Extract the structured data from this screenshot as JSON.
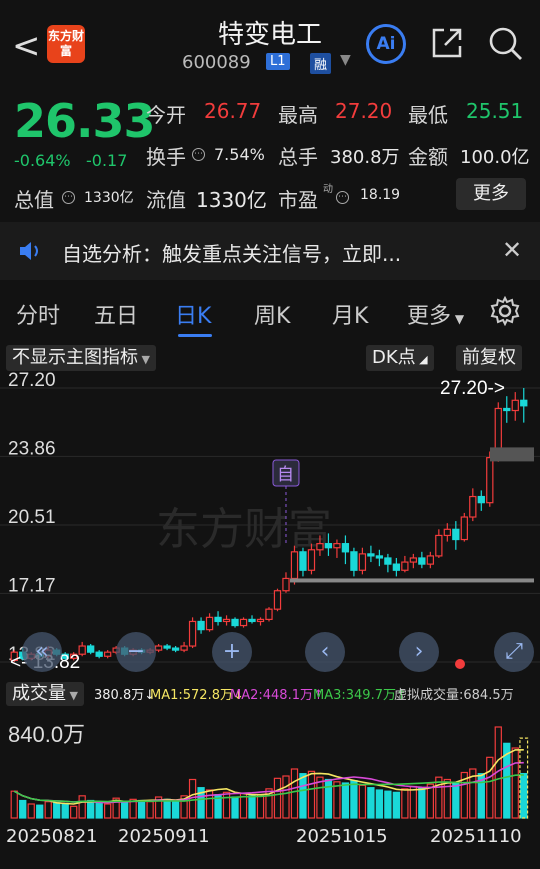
{
  "header": {
    "back_label": "<",
    "brand_label": "东方财富",
    "title": "特变电工",
    "code": "600089",
    "tag_l1": "L1",
    "tag_margin": "融"
  },
  "quote": {
    "price": "26.33",
    "change_pct": "-0.64%",
    "change_amt": "-0.17",
    "rows": [
      {
        "label": "今开",
        "value": "26.77"
      },
      {
        "label": "最高",
        "value": "27.20"
      },
      {
        "label": "最低",
        "value": "25.51"
      },
      {
        "label": "换手",
        "value": "7.54%"
      },
      {
        "label": "总手",
        "value": "380.8万"
      },
      {
        "label": "金额",
        "value": "100.0亿"
      },
      {
        "label": "总值",
        "value": "1330亿"
      },
      {
        "label": "流值",
        "value": "1330亿"
      },
      {
        "label": "市盈",
        "value": "18.19"
      }
    ],
    "pe_sup": "动",
    "more_label": "更多"
  },
  "banner": {
    "text": "自选分析：触发重点关注信号，立即..."
  },
  "tabs": [
    "分时",
    "五日",
    "日K",
    "周K",
    "月K",
    "更多"
  ],
  "toolbar": {
    "indicator_label": "不显示主图指标",
    "dk_label": "DK点",
    "adjust_label": "前复权"
  },
  "colors": {
    "up": "#f23c3c",
    "down": "#1ad8d8",
    "accent": "#3a7df2",
    "ma1": "#f5e663",
    "ma2": "#d84ad8",
    "ma3": "#3cc84a"
  },
  "chart_data": {
    "type": "candlestick",
    "y_ticks": [
      "27.20",
      "23.86",
      "20.51",
      "17.17",
      "13.82"
    ],
    "ylim": [
      13.82,
      27.2
    ],
    "max_label": "27.20->",
    "min_label": "<- 13.82",
    "marker_label": "自",
    "candles": [
      [
        13.9,
        14.3,
        13.82,
        14.4
      ],
      [
        14.3,
        14.0,
        13.9,
        14.5
      ],
      [
        14.0,
        14.2,
        13.9,
        14.3
      ],
      [
        14.2,
        14.1,
        14.0,
        14.4
      ],
      [
        14.1,
        14.4,
        14.0,
        14.6
      ],
      [
        14.4,
        14.2,
        14.1,
        14.5
      ],
      [
        14.2,
        14.0,
        13.9,
        14.3
      ],
      [
        14.0,
        14.2,
        13.9,
        14.3
      ],
      [
        14.2,
        14.6,
        14.1,
        14.8
      ],
      [
        14.6,
        14.3,
        14.2,
        14.7
      ],
      [
        14.3,
        14.1,
        14.0,
        14.4
      ],
      [
        14.1,
        14.3,
        14.0,
        14.4
      ],
      [
        14.3,
        14.5,
        14.2,
        14.6
      ],
      [
        14.5,
        14.2,
        14.1,
        14.6
      ],
      [
        14.2,
        14.4,
        14.1,
        14.5
      ],
      [
        14.4,
        14.3,
        14.2,
        14.5
      ],
      [
        14.3,
        14.4,
        14.2,
        14.5
      ],
      [
        14.4,
        14.6,
        14.3,
        14.7
      ],
      [
        14.6,
        14.5,
        14.4,
        14.7
      ],
      [
        14.5,
        14.4,
        14.3,
        14.6
      ],
      [
        14.4,
        14.6,
        14.3,
        14.8
      ],
      [
        14.6,
        15.8,
        14.5,
        16.0
      ],
      [
        15.8,
        15.4,
        15.2,
        16.0
      ],
      [
        15.4,
        16.0,
        15.3,
        16.2
      ],
      [
        16.0,
        15.8,
        15.6,
        16.3
      ],
      [
        15.8,
        15.9,
        15.6,
        16.1
      ],
      [
        15.9,
        15.6,
        15.5,
        16.0
      ],
      [
        15.6,
        15.9,
        15.5,
        16.0
      ],
      [
        15.9,
        15.8,
        15.7,
        16.1
      ],
      [
        15.8,
        15.9,
        15.6,
        16.0
      ],
      [
        15.9,
        16.4,
        15.8,
        16.5
      ],
      [
        16.4,
        17.3,
        16.3,
        17.4
      ],
      [
        17.3,
        17.9,
        17.2,
        18.2
      ],
      [
        17.9,
        19.2,
        17.6,
        19.5
      ],
      [
        19.2,
        18.3,
        18.0,
        19.4
      ],
      [
        18.3,
        19.3,
        18.1,
        19.6
      ],
      [
        19.3,
        19.6,
        19.0,
        20.0
      ],
      [
        19.6,
        19.4,
        19.0,
        20.1
      ],
      [
        19.4,
        19.6,
        18.9,
        19.8
      ],
      [
        19.6,
        19.2,
        18.6,
        20.0
      ],
      [
        19.2,
        18.3,
        18.0,
        19.4
      ],
      [
        18.3,
        19.1,
        18.1,
        19.4
      ],
      [
        19.1,
        19.0,
        18.7,
        19.5
      ],
      [
        19.0,
        18.9,
        18.5,
        19.3
      ],
      [
        18.9,
        18.6,
        18.2,
        19.1
      ],
      [
        18.6,
        18.3,
        18.0,
        18.9
      ],
      [
        18.3,
        18.7,
        18.2,
        19.0
      ],
      [
        18.7,
        18.9,
        18.4,
        19.1
      ],
      [
        18.9,
        18.6,
        18.4,
        19.2
      ],
      [
        18.6,
        19.0,
        18.4,
        19.2
      ],
      [
        19.0,
        20.0,
        18.9,
        20.3
      ],
      [
        20.0,
        20.3,
        19.7,
        20.6
      ],
      [
        20.3,
        19.8,
        19.3,
        20.7
      ],
      [
        19.8,
        20.9,
        19.7,
        21.1
      ],
      [
        20.9,
        21.9,
        20.7,
        22.3
      ],
      [
        21.9,
        21.6,
        21.2,
        22.2
      ],
      [
        21.6,
        23.8,
        21.4,
        24.1
      ],
      [
        23.8,
        26.2,
        23.6,
        26.5
      ],
      [
        26.2,
        26.1,
        25.5,
        26.8
      ],
      [
        26.1,
        26.6,
        25.6,
        27.0
      ],
      [
        26.6,
        26.33,
        25.51,
        27.2
      ]
    ],
    "volume": {
      "label": "成交量",
      "current": "380.8万↓",
      "ma1_label": "MA1:572.8万↓",
      "ma2_label": "MA2:448.1万↑",
      "ma3_label": "MA3:349.7万↑",
      "virtual_label": "虚拟成交量:684.5万",
      "max_label": "840.0万",
      "ymax": 840,
      "values": [
        230,
        150,
        120,
        110,
        140,
        130,
        120,
        100,
        190,
        150,
        130,
        120,
        170,
        140,
        160,
        150,
        140,
        180,
        160,
        140,
        190,
        330,
        260,
        240,
        200,
        220,
        180,
        210,
        190,
        200,
        250,
        340,
        360,
        420,
        380,
        400,
        350,
        330,
        310,
        300,
        320,
        280,
        260,
        240,
        230,
        220,
        250,
        270,
        260,
        290,
        350,
        330,
        300,
        390,
        420,
        380,
        520,
        780,
        640,
        600,
        380.8
      ]
    },
    "dates": [
      "20250821",
      "20250911",
      "20251015",
      "20251110"
    ]
  }
}
